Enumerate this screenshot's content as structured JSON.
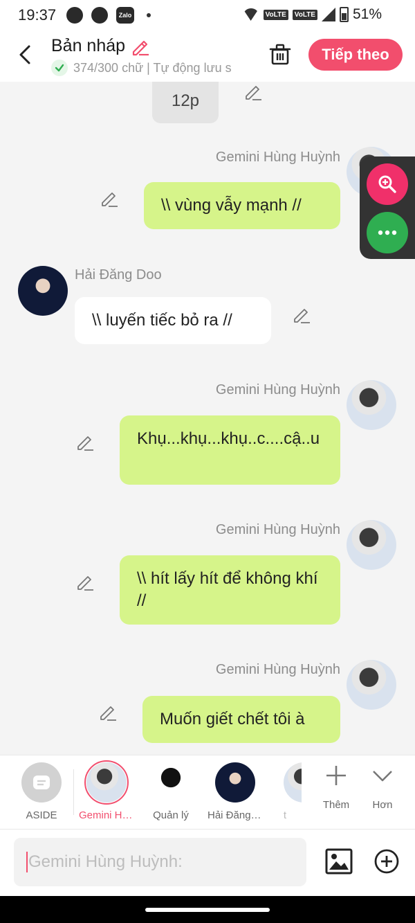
{
  "status_bar": {
    "time": "19:37",
    "battery": "51%",
    "volte_1": "VoLTE",
    "volte_2": "VoLTE",
    "zalo": "Zalo"
  },
  "header": {
    "title": "Bản nháp",
    "subtitle": "374/300 chữ | Tự động lưu s",
    "next_label": "Tiếp theo"
  },
  "chat": {
    "top_bubble": "12p",
    "messages": [
      {
        "name": "Gemini Hùng Huỳnh",
        "text": "\\\\ vùng vẫy mạnh //"
      },
      {
        "name": "Hải Đăng Doo",
        "text": "\\\\ luyến tiếc bỏ ra //"
      },
      {
        "name": "Gemini Hùng Huỳnh",
        "text": "Khụ...khụ...khụ..c....cậ..u"
      },
      {
        "name": "Gemini Hùng Huỳnh",
        "text": "\\\\ hít lấy hít để không khí //"
      },
      {
        "name": "Gemini Hùng Huỳnh",
        "text": "Muốn giết chết tôi à"
      }
    ]
  },
  "characters": {
    "items": [
      {
        "label": "ASIDE"
      },
      {
        "label": "Gemini Hùng Huỳnh"
      },
      {
        "label": "Quản lý"
      },
      {
        "label": "Hải Đăng Doo"
      },
      {
        "label": "t"
      }
    ],
    "add_label": "Thêm",
    "more_label": "Hơn"
  },
  "input": {
    "placeholder": "Gemini Hùng Huỳnh:"
  },
  "colors": {
    "accent": "#f24e6d",
    "mine_bubble": "#d6f48a",
    "zoom": "#f0306a",
    "more": "#2fae51"
  }
}
